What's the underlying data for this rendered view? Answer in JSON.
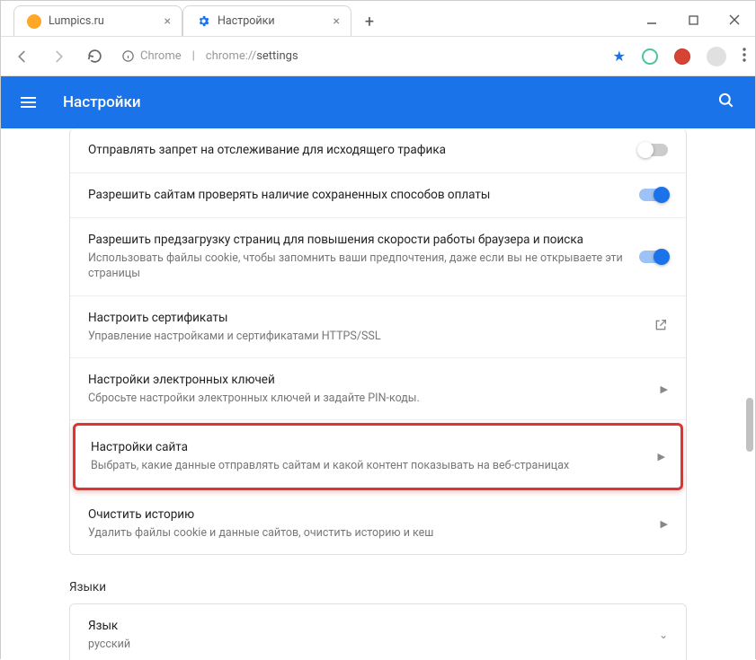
{
  "window": {
    "tabs": [
      {
        "title": "Lumpics.ru"
      },
      {
        "title": "Настройки"
      }
    ],
    "newtab": "+"
  },
  "address": {
    "chrome_label": "Chrome",
    "url_prefix": "chrome://",
    "url_path": "settings"
  },
  "header": {
    "title": "Настройки"
  },
  "rows": {
    "dnt": {
      "title": "Отправлять запрет на отслеживание для исходящего трафика"
    },
    "payments": {
      "title": "Разрешить сайтам проверять наличие сохраненных способов оплаты"
    },
    "preload": {
      "title": "Разрешить предзагрузку страниц для повышения скорости работы браузера и поиска",
      "sub": "Использовать файлы cookie, чтобы запомнить ваши предпочтения, даже если вы не открываете эти страницы"
    },
    "certs": {
      "title": "Настроить сертификаты",
      "sub": "Управление настройками и сертификатами HTTPS/SSL"
    },
    "keys": {
      "title": "Настройки электронных ключей",
      "sub": "Сбросьте настройки электронных ключей и задайте PIN-коды."
    },
    "site": {
      "title": "Настройки сайта",
      "sub": "Выбрать, какие данные отправлять сайтам и какой контент показывать на веб-страницах"
    },
    "clear": {
      "title": "Очистить историю",
      "sub": "Удалить файлы cookie и данные сайтов, очистить историю и кеш"
    }
  },
  "sections": {
    "languages_label": "Языки",
    "language": {
      "title": "Язык",
      "sub": "русский"
    }
  }
}
